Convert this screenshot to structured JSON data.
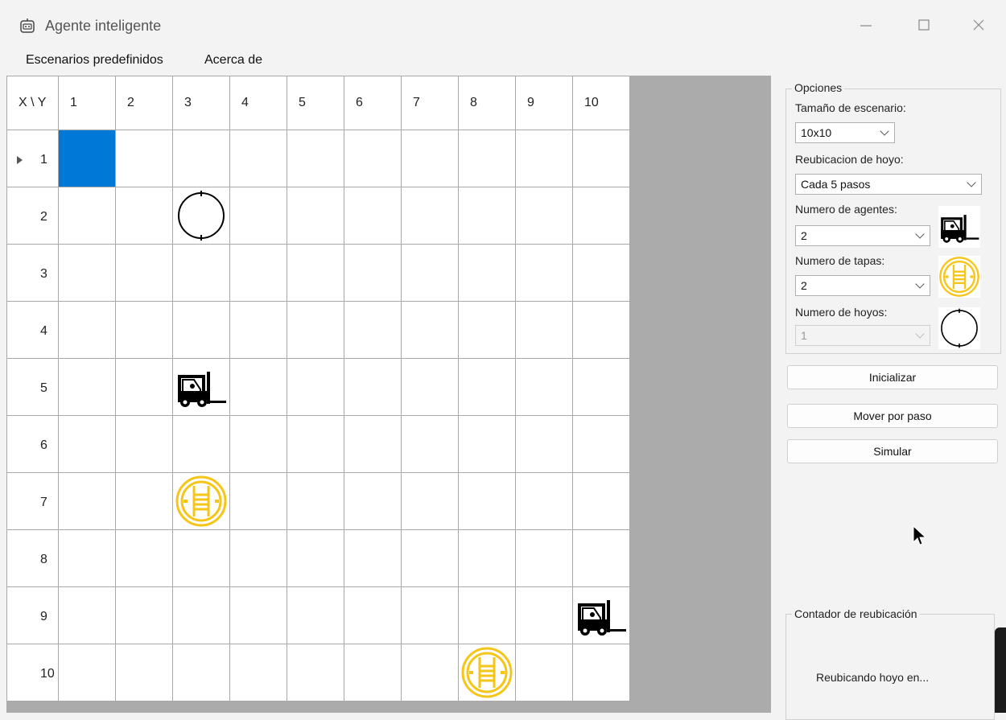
{
  "window": {
    "title": "Agente inteligente"
  },
  "menu": {
    "items": [
      "Escenarios predefinidos",
      "Acerca de"
    ]
  },
  "grid": {
    "corner": "X \\ Y",
    "columns": [
      "1",
      "2",
      "3",
      "4",
      "5",
      "6",
      "7",
      "8",
      "9",
      "10"
    ],
    "rows": [
      "1",
      "2",
      "3",
      "4",
      "5",
      "6",
      "7",
      "8",
      "9",
      "10"
    ],
    "selected_cell": {
      "row": 1,
      "col": 1
    },
    "entities": [
      {
        "type": "hoyo",
        "row": 2,
        "col": 3
      },
      {
        "type": "agente",
        "row": 5,
        "col": 3
      },
      {
        "type": "tapa",
        "row": 7,
        "col": 3
      },
      {
        "type": "agente",
        "row": 9,
        "col": 10
      },
      {
        "type": "tapa",
        "row": 10,
        "col": 8
      }
    ]
  },
  "options": {
    "title": "Opciones",
    "size_label": "Tamaño de escenario:",
    "size_value": "10x10",
    "relocation_label": "Reubicacion de hoyo:",
    "relocation_value": "Cada 5 pasos",
    "agents_label": "Numero de agentes:",
    "agents_value": "2",
    "covers_label": "Numero de tapas:",
    "covers_value": "2",
    "holes_label": "Numero de hoyos:",
    "holes_value": "1"
  },
  "buttons": {
    "init": "Inicializar",
    "step": "Mover por paso",
    "simulate": "Simular"
  },
  "counter": {
    "title": "Contador de reubicación",
    "text": "Reubicando hoyo en..."
  },
  "icons": {
    "agente": "forklift-icon",
    "tapa": "manhole-cover-icon",
    "hoyo": "hole-icon"
  },
  "colors": {
    "selected": "#0078d7",
    "cover": "#f5c518"
  }
}
